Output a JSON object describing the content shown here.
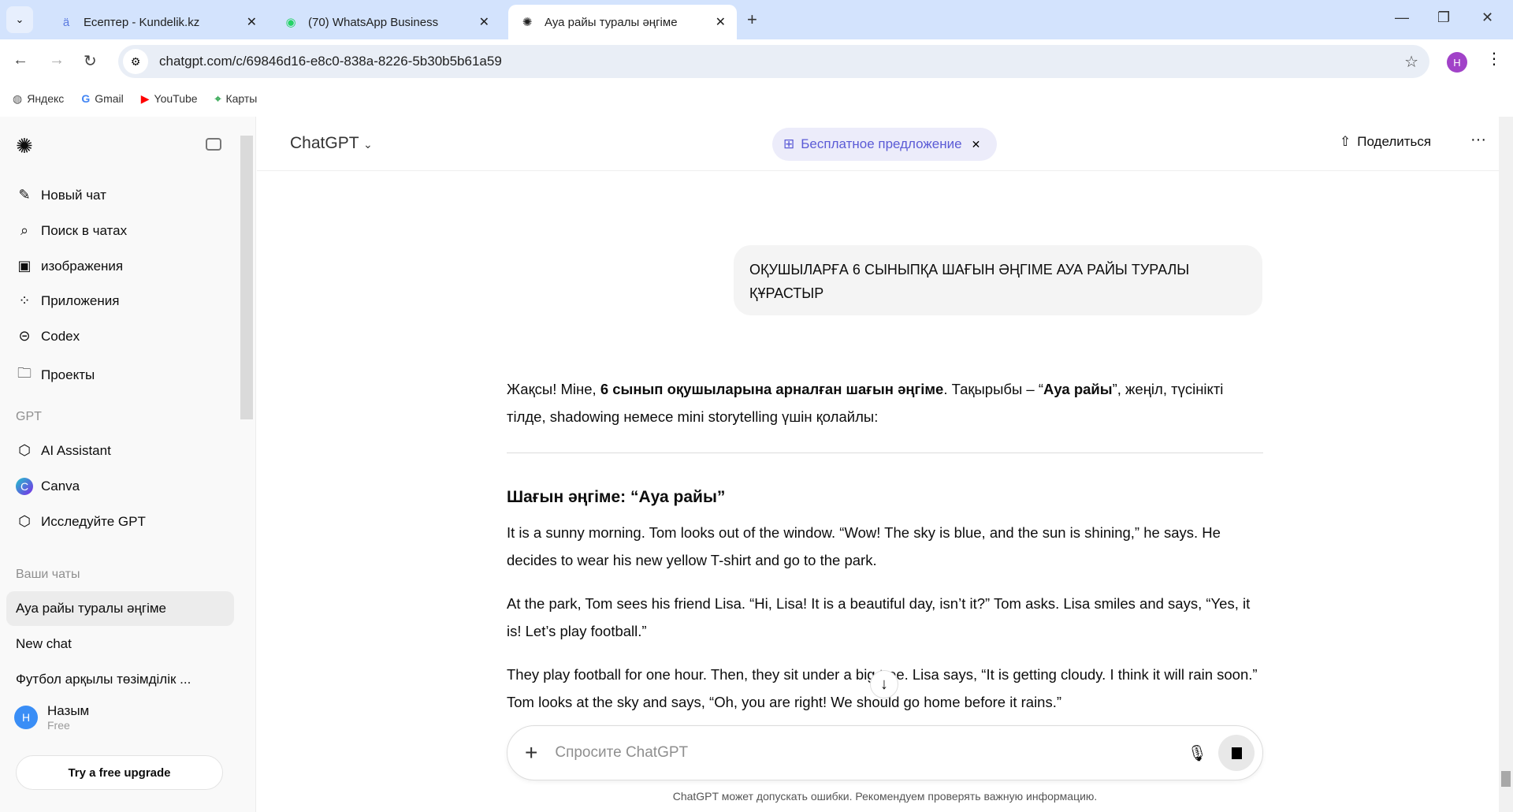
{
  "browser": {
    "tabs": [
      {
        "title": "Есептер - Kundelik.kz",
        "icon": "kundelik-icon"
      },
      {
        "title": "(70) WhatsApp Business",
        "icon": "whatsapp-icon"
      },
      {
        "title": "Ауа райы туралы әңгіме",
        "icon": "chatgpt-icon",
        "active": true
      }
    ],
    "url": "chatgpt.com/c/69846d16-e8c0-838a-8226-5b30b5b61a59",
    "profile_initial": "Н",
    "bookmarks": [
      "Яндекс",
      "Gmail",
      "YouTube",
      "Карты"
    ]
  },
  "sidebar": {
    "nav": [
      "Новый чат",
      "Поиск в чатах",
      "изображения",
      "Приложения",
      "Codex",
      "Проекты"
    ],
    "gpt_heading": "GPT",
    "gpts": [
      "AI Assistant",
      "Canva",
      "Исследуйте GPT"
    ],
    "chats_heading": "Ваши чаты",
    "chats": [
      "Ауа райы туралы әңгіме",
      "New chat",
      "Футбол арқылы төзімділік ..."
    ],
    "user": {
      "initial": "Н",
      "name": "Назым",
      "plan": "Free"
    },
    "upgrade": "Try a free upgrade"
  },
  "header": {
    "model": "ChatGPT",
    "offer": "Бесплатное предложение",
    "share": "Поделиться"
  },
  "conversation": {
    "user_message": "ОҚУШЫЛАРҒА 6 СЫНЫПҚА ШАҒЫН ӘҢГІМЕ АУА РАЙЫ ТУРАЛЫ ҚҰРАСТЫР",
    "intro": {
      "a": "Жақсы! Міне, ",
      "b": "6 сынып оқушыларына арналған шағын әңгіме",
      "c": ". Тақырыбы – “",
      "d": "Ауа райы",
      "e": "”, жеңіл, түсінікті тілде, shadowing немесе mini storytelling үшін қолайлы:"
    },
    "title": "Шағын әңгіме: “Ауа райы”",
    "paragraphs": [
      "It is a sunny morning. Tom looks out of the window. “Wow! The sky is blue, and the sun is shining,” he says. He decides to wear his new yellow T-shirt and go to the park.",
      "At the park, Tom sees his friend Lisa. “Hi, Lisa! It is a beautiful day, isn’t it?” Tom asks. Lisa smiles and says, “Yes, it is! Let’s play football.”",
      "They play football for one hour. Then, they sit under a big tree. Lisa says, “It is getting cloudy. I think it will rain soon.” Tom looks at the sky and says, “Oh, you are right! We should go home before it rains.”"
    ]
  },
  "composer": {
    "placeholder": "Спросите ChatGPT",
    "disclaimer": "ChatGPT может допускать ошибки. Рекомендуем проверять важную информацию."
  }
}
